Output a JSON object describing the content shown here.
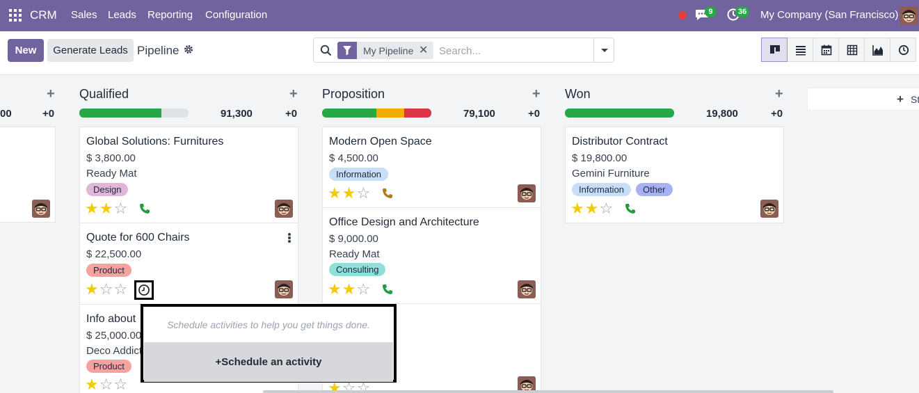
{
  "topbar": {
    "app_name": "CRM",
    "menu": [
      "Sales",
      "Leads",
      "Reporting",
      "Configuration"
    ],
    "messages_count": "9",
    "activities_count": "36",
    "company": "My Company (San Francisco)"
  },
  "control": {
    "new_label": "New",
    "generate_label": "Generate Leads",
    "breadcrumb": "Pipeline",
    "search": {
      "facet": "My Pipeline",
      "placeholder": "Search..."
    },
    "views": [
      "kanban-icon",
      "list-icon",
      "calendar-icon",
      "pivot-icon",
      "graph-icon",
      "activity-icon"
    ]
  },
  "columns": [
    {
      "name": "",
      "total": "00",
      "plus": "+0"
    },
    {
      "name": "Qualified",
      "total": "91,300",
      "plus": "+0"
    },
    {
      "name": "Proposition",
      "total": "79,100",
      "plus": "+0"
    },
    {
      "name": "Won",
      "total": "19,800",
      "plus": "+0"
    }
  ],
  "cards": {
    "global": {
      "title": "Global Solutions: Furnitures",
      "amount": "$ 3,800.00",
      "company": "Ready Mat",
      "tags": [
        "Design"
      ],
      "priority": 2
    },
    "chairs": {
      "title": "Quote for 600 Chairs",
      "amount": "$ 22,500.00",
      "tags": [
        "Product"
      ],
      "priority": 1
    },
    "infoabout": {
      "title": "Info about",
      "amount": "$ 25,000.00",
      "company": "Deco Addict",
      "tags": [
        "Product"
      ],
      "priority": 1
    },
    "openspace": {
      "title": "Modern Open Space",
      "amount": "$ 4,500.00",
      "tags": [
        "Information"
      ],
      "priority": 2
    },
    "office": {
      "title": "Office Design and Architecture",
      "amount": "$ 9,000.00",
      "company": "Ready Mat",
      "tags": [
        "Consulting"
      ],
      "priority": 2
    },
    "distributor": {
      "title": "Distributor Contract",
      "amount": "$ 19,800.00",
      "company": "Gemini Furniture",
      "tags": [
        "Information",
        "Other"
      ],
      "priority": 2
    }
  },
  "popover": {
    "message": "Schedule activities to help you get things done.",
    "action": "Schedule an activity"
  },
  "add_column_label": "St",
  "colors": {
    "brand": "#71639e",
    "progress_green": "#28a745",
    "progress_orange": "#f0ad00",
    "progress_red": "#dc3545",
    "tag_design": "#e0b7d8",
    "tag_product": "#f7a1a1",
    "tag_information": "#c6def8",
    "tag_consulting": "#8fe0d9",
    "tag_other": "#a9b1f5"
  }
}
